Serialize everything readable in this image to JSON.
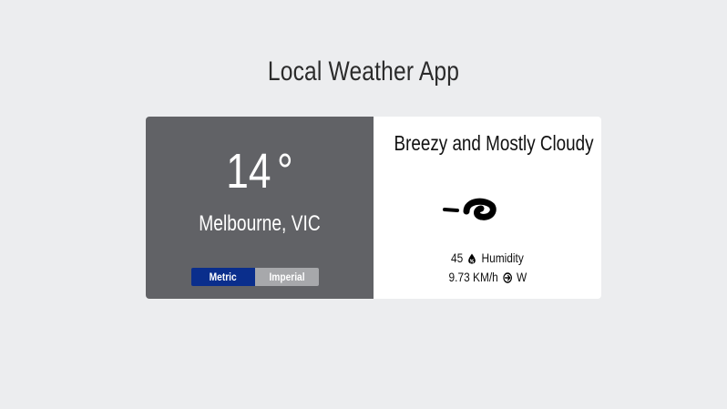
{
  "app": {
    "title": "Local Weather App"
  },
  "current": {
    "temperature": "14",
    "degree_symbol": "°",
    "location": "Melbourne, VIC",
    "condition": "Breezy and Mostly Cloudy",
    "humidity_value": "45",
    "humidity_label": "Humidity",
    "wind_speed": "9.73 KM/h",
    "wind_direction": "W"
  },
  "units": {
    "metric_label": "Metric",
    "imperial_label": "Imperial",
    "selected": "Metric"
  },
  "icons": {
    "weather": "windy-cloudy-icon",
    "humidity": "humidity-drop-icon",
    "wind": "wind-direction-icon"
  },
  "colors": {
    "page_bg": "#ecedef",
    "left_panel": "#616266",
    "metric_active": "#0a2e8c",
    "imperial_inactive": "#a7a8ab"
  }
}
